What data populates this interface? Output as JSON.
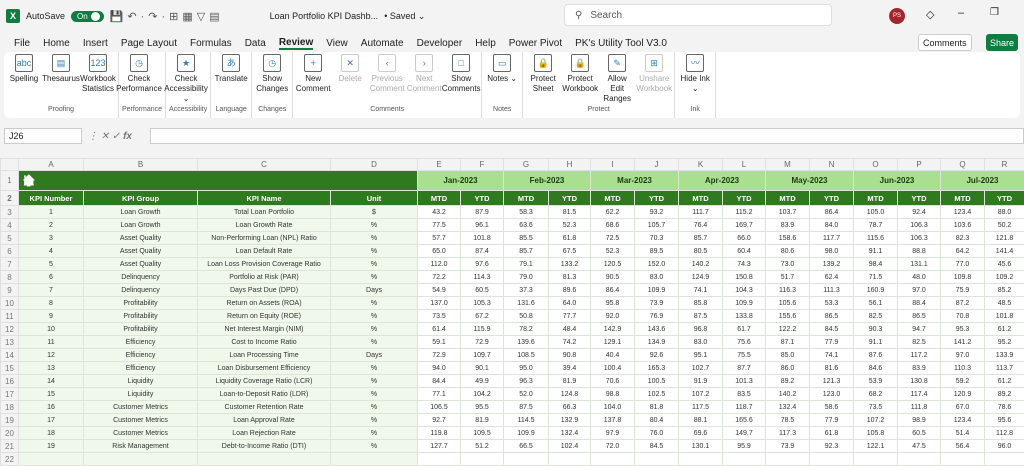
{
  "titlebar": {
    "autosave": "AutoSave",
    "toggle": "On",
    "doc_title": "Loan Portfolio KPI Dashb...",
    "saved": "• Saved ⌄",
    "search_placeholder": "Search",
    "avatar": "PS"
  },
  "tabs": [
    "File",
    "Home",
    "Insert",
    "Page Layout",
    "Formulas",
    "Data",
    "Review",
    "View",
    "Automate",
    "Developer",
    "Help",
    "Power Pivot",
    "PK's Utility Tool V3.0"
  ],
  "active_tab": "Review",
  "comments_button": "Comments",
  "share_button": "Share",
  "ribbon": [
    {
      "label": "Proofing",
      "buttons": [
        {
          "t": "Spelling",
          "i": "abc"
        },
        {
          "t": "Thesaurus",
          "i": "▤"
        },
        {
          "t": "Workbook Statistics",
          "i": "123"
        }
      ]
    },
    {
      "label": "Performance",
      "buttons": [
        {
          "t": "Check Performance",
          "i": "◷"
        }
      ]
    },
    {
      "label": "Accessibility",
      "buttons": [
        {
          "t": "Check Accessibility ⌄",
          "i": "★"
        }
      ]
    },
    {
      "label": "Language",
      "buttons": [
        {
          "t": "Translate",
          "i": "あ"
        }
      ]
    },
    {
      "label": "Changes",
      "buttons": [
        {
          "t": "Show Changes",
          "i": "◷"
        }
      ]
    },
    {
      "label": "Comments",
      "buttons": [
        {
          "t": "New Comment",
          "i": "+"
        },
        {
          "t": "Delete",
          "i": "✕",
          "d": true
        },
        {
          "t": "Previous Comment",
          "i": "‹",
          "d": true
        },
        {
          "t": "Next Comment",
          "i": "›",
          "d": true
        },
        {
          "t": "Show Comments",
          "i": "□"
        }
      ]
    },
    {
      "label": "Notes",
      "buttons": [
        {
          "t": "Notes ⌄",
          "i": "▭"
        }
      ]
    },
    {
      "label": "Protect",
      "buttons": [
        {
          "t": "Protect Sheet",
          "i": "🔒"
        },
        {
          "t": "Protect Workbook",
          "i": "🔒"
        },
        {
          "t": "Allow Edit Ranges",
          "i": "✎"
        },
        {
          "t": "Unshare Workbook",
          "i": "⊞",
          "d": true
        }
      ]
    },
    {
      "label": "Ink",
      "buttons": [
        {
          "t": "Hide Ink ⌄",
          "i": "〰"
        }
      ]
    }
  ],
  "formula_bar": {
    "name_box": "J26",
    "fx": "fx",
    "value": ""
  },
  "columns": [
    "A",
    "B",
    "C",
    "D",
    "E",
    "F",
    "G",
    "H",
    "I",
    "J",
    "K",
    "L",
    "M",
    "N",
    "O",
    "P",
    "Q",
    "R"
  ],
  "months": [
    "Jan-2023",
    "Feb-2023",
    "Mar-2023",
    "Apr-2023",
    "May-2023",
    "Jun-2023",
    "Jul-2023"
  ],
  "headers": [
    "KPI Number",
    "KPI Group",
    "KPI Name",
    "Unit"
  ],
  "sub_headers": [
    "MTD",
    "YTD"
  ],
  "rows": [
    [
      "1",
      "Loan Growth",
      "Total Loan Portfolio",
      "$",
      "43.2",
      "87.9",
      "58.3",
      "81.5",
      "62.2",
      "93.2",
      "111.7",
      "115.2",
      "103.7",
      "86.4",
      "105.0",
      "92.4",
      "123.4",
      "88.0"
    ],
    [
      "2",
      "Loan Growth",
      "Loan Growth Rate",
      "%",
      "77.5",
      "96.1",
      "63.6",
      "52.3",
      "68.6",
      "105.7",
      "76.4",
      "169.7",
      "83.9",
      "84.0",
      "78.7",
      "106.3",
      "103.6",
      "50.2"
    ],
    [
      "3",
      "Asset Quality",
      "Non-Performing Loan (NPL) Ratio",
      "%",
      "57.7",
      "101.8",
      "85.5",
      "61.8",
      "72.5",
      "70.3",
      "85.7",
      "66.0",
      "158.6",
      "117.7",
      "115.6",
      "106.3",
      "82.3",
      "121.8"
    ],
    [
      "4",
      "Asset Quality",
      "Loan Default Rate",
      "%",
      "65.0",
      "87.4",
      "85.7",
      "67.5",
      "52.3",
      "89.5",
      "80.5",
      "60.4",
      "80.6",
      "98.0",
      "91.1",
      "88.8",
      "64.2",
      "141.4"
    ],
    [
      "5",
      "Asset Quality",
      "Loan Loss Provision Coverage Ratio",
      "%",
      "112.0",
      "97.6",
      "79.1",
      "133.2",
      "120.5",
      "152.0",
      "140.2",
      "74.3",
      "73.0",
      "139.2",
      "98.4",
      "131.1",
      "77.0",
      "45.6"
    ],
    [
      "6",
      "Delinquency",
      "Portfolio at Risk (PAR)",
      "%",
      "72.2",
      "114.3",
      "79.0",
      "81.3",
      "90.5",
      "83.0",
      "124.9",
      "150.8",
      "51.7",
      "62.4",
      "71.5",
      "48.0",
      "109.8",
      "109.2"
    ],
    [
      "7",
      "Delinquency",
      "Days Past Due (DPD)",
      "Days",
      "54.9",
      "60.5",
      "37.3",
      "89.6",
      "86.4",
      "109.9",
      "74.1",
      "104.3",
      "116.3",
      "111.3",
      "160.9",
      "97.0",
      "75.9",
      "85.2"
    ],
    [
      "8",
      "Profitability",
      "Return on Assets (ROA)",
      "%",
      "137.0",
      "105.3",
      "131.6",
      "64.0",
      "95.8",
      "73.9",
      "85.8",
      "109.9",
      "105.6",
      "53.3",
      "56.1",
      "88.4",
      "87.2",
      "48.5"
    ],
    [
      "9",
      "Profitability",
      "Return on Equity (ROE)",
      "%",
      "73.5",
      "67.2",
      "50.8",
      "77.7",
      "92.0",
      "76.9",
      "87.5",
      "133.8",
      "155.6",
      "86.5",
      "82.5",
      "86.5",
      "70.8",
      "101.8"
    ],
    [
      "10",
      "Profitability",
      "Net Interest Margin (NIM)",
      "%",
      "61.4",
      "115.9",
      "78.2",
      "48.4",
      "142.9",
      "143.6",
      "96.8",
      "61.7",
      "122.2",
      "84.5",
      "90.3",
      "94.7",
      "95.3",
      "61.2"
    ],
    [
      "11",
      "Efficiency",
      "Cost to Income Ratio",
      "%",
      "59.1",
      "72.9",
      "139.6",
      "74.2",
      "129.1",
      "134.9",
      "83.0",
      "75.6",
      "87.1",
      "77.9",
      "91.1",
      "82.5",
      "141.2",
      "95.2"
    ],
    [
      "12",
      "Efficiency",
      "Loan Processing Time",
      "Days",
      "72.9",
      "109.7",
      "108.5",
      "90.8",
      "40.4",
      "92.6",
      "95.1",
      "75.5",
      "85.0",
      "74.1",
      "87.6",
      "117.2",
      "97.0",
      "133.9"
    ],
    [
      "13",
      "Efficiency",
      "Loan Disbursement Efficiency",
      "%",
      "94.0",
      "90.1",
      "95.0",
      "39.4",
      "100.4",
      "165.3",
      "102.7",
      "87.7",
      "86.0",
      "81.6",
      "84.6",
      "83.9",
      "110.3",
      "113.7"
    ],
    [
      "14",
      "Liquidity",
      "Liquidity Coverage Ratio (LCR)",
      "%",
      "84.4",
      "49.9",
      "96.3",
      "81.9",
      "70.6",
      "100.5",
      "91.9",
      "101.3",
      "89.2",
      "121.3",
      "53.9",
      "130.8",
      "59.2",
      "61.2"
    ],
    [
      "15",
      "Liquidity",
      "Loan-to-Deposit Ratio (LDR)",
      "%",
      "77.1",
      "104.2",
      "52.0",
      "124.8",
      "98.8",
      "102.5",
      "107.2",
      "83.5",
      "140.2",
      "123.0",
      "68.2",
      "117.4",
      "120.9",
      "89.2"
    ],
    [
      "16",
      "Customer Metrics",
      "Customer Retention Rate",
      "%",
      "106.5",
      "95.5",
      "87.5",
      "66.3",
      "104.0",
      "81.8",
      "117.5",
      "118.7",
      "132.4",
      "58.6",
      "73.5",
      "111.8",
      "67.0",
      "78.6"
    ],
    [
      "17",
      "Customer Metrics",
      "Loan Approval Rate",
      "%",
      "92.7",
      "81.9",
      "114.5",
      "132.9",
      "137.8",
      "80.4",
      "88.1",
      "165.6",
      "78.5",
      "77.9",
      "107.2",
      "98.9",
      "123.4",
      "95.6"
    ],
    [
      "18",
      "Customer Metrics",
      "Loan Rejection Rate",
      "%",
      "119.8",
      "109.5",
      "109.9",
      "132.4",
      "97.9",
      "76.0",
      "69.6",
      "149.7",
      "117.3",
      "61.8",
      "105.8",
      "60.5",
      "51.4",
      "112.8"
    ],
    [
      "19",
      "Risk Management",
      "Debt-to-Income Ratio (DTI)",
      "%",
      "127.7",
      "51.2",
      "66.5",
      "102.4",
      "72.0",
      "84.5",
      "130.1",
      "95.9",
      "73.9",
      "92.3",
      "122.1",
      "47.5",
      "56.4",
      "96.0"
    ]
  ]
}
